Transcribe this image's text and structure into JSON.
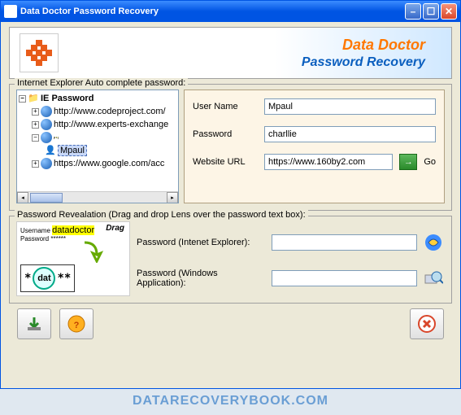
{
  "titlebar": {
    "title": "Data Doctor Password Recovery"
  },
  "header": {
    "brand": "Data Doctor",
    "sub": "Password Recovery"
  },
  "section_ie": {
    "label": "Internet Explorer Auto complete password:",
    "tree_root": "IE Password",
    "tree_items": [
      "http://www.codeproject.com/",
      "http://www.experts-exchange",
      "",
      "https://www.google.com/acc"
    ],
    "selected_item": "Mpaul",
    "fields": {
      "username_label": "User Name",
      "username_value": "Mpaul",
      "password_label": "Password",
      "password_value": "charllie",
      "url_label": "Website URL",
      "url_value": "https://www.160by2.com",
      "go_label": "Go"
    }
  },
  "section_reveal": {
    "label": "Password Revealation (Drag and drop Lens over the password text box):",
    "illus_drag": "Drag",
    "illus_lens_text": "dat",
    "ie_label": "Password (Intenet Explorer):",
    "ie_value": "",
    "win_label": "Password (Windows Application):",
    "win_value": ""
  },
  "watermark": "DATARECOVERYBOOK.COM"
}
